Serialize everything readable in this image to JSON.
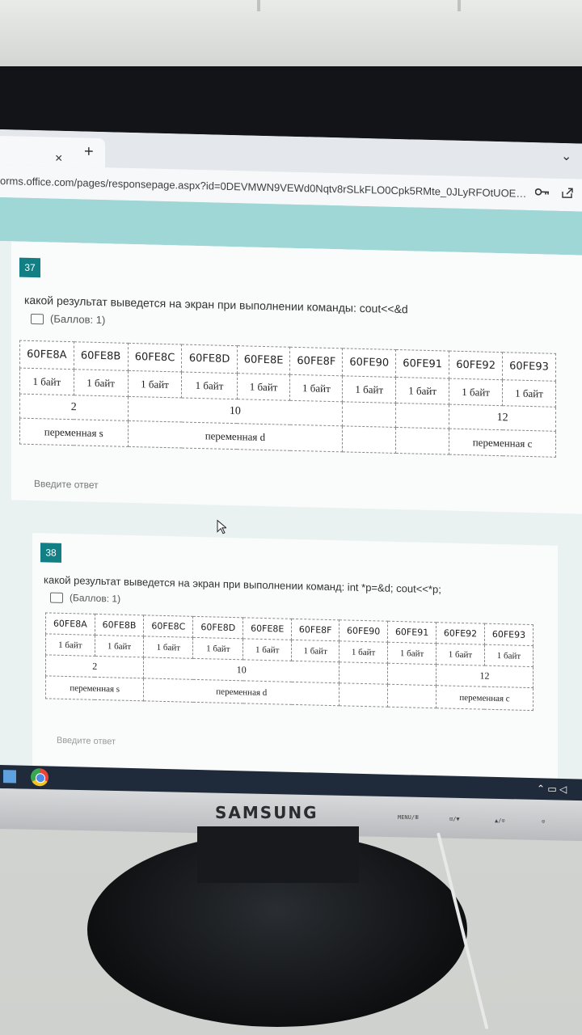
{
  "browser": {
    "url": "orms.office.com/pages/responsepage.aspx?id=0DEVMWN9VEWd0Nqtv8rSLkFLO0Cpk5RMte_0JLyRFOtUOE…",
    "tab_close": "×",
    "tab_new": "+",
    "chevron": "⌄",
    "icons": [
      "key-icon",
      "share-icon"
    ]
  },
  "questions": [
    {
      "number": "37",
      "text": "какой результат выведется на экран при выполнении команды: cout<<&d",
      "points": "(Баллов: 1)",
      "answer_placeholder": "Введите ответ"
    },
    {
      "number": "38",
      "text": "какой результат выведется на экран при выполнении команд:  int *p=&d; cout<<*p;",
      "points": "(Баллов: 1)",
      "answer_placeholder": "Введите ответ"
    }
  ],
  "memory_table": {
    "addresses": [
      "60FE8A",
      "60FE8B",
      "60FE8C",
      "60FE8D",
      "60FE8E",
      "60FE8F",
      "60FE90",
      "60FE91",
      "60FE92",
      "60FE93"
    ],
    "byte_label": "1 байт",
    "values": {
      "s": "2",
      "d": "10",
      "c": "12"
    },
    "variables": {
      "s": "переменная s",
      "d": "переменная d",
      "c": "переменная с"
    }
  },
  "monitor": {
    "brand": "SAMSUNG",
    "button_labels": [
      "MENU/Ⅲ",
      "⊡/▼",
      "▲/⊙",
      "⊙"
    ]
  },
  "colors": {
    "accent": "#127f85",
    "banner": "#9fd6d6",
    "bezel": "#121418"
  }
}
